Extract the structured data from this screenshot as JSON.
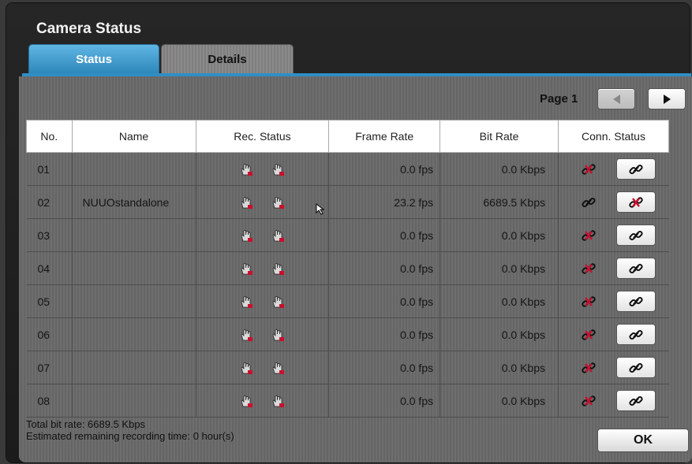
{
  "window": {
    "title": "Camera Status",
    "tabs": [
      {
        "label": "Status",
        "active": true
      },
      {
        "label": "Details",
        "active": false
      }
    ]
  },
  "pager": {
    "label": "Page 1"
  },
  "table": {
    "headers": [
      "No.",
      "Name",
      "Rec. Status",
      "Frame Rate",
      "Bit Rate",
      "Conn. Status"
    ],
    "rows": [
      {
        "no": "01",
        "name": "",
        "fps": "0.0 fps",
        "bitrate": "0.0 Kbps",
        "connected": false
      },
      {
        "no": "02",
        "name": "NUUOstandalone",
        "fps": "23.2 fps",
        "bitrate": "6689.5 Kbps",
        "connected": true
      },
      {
        "no": "03",
        "name": "",
        "fps": "0.0 fps",
        "bitrate": "0.0 Kbps",
        "connected": false
      },
      {
        "no": "04",
        "name": "",
        "fps": "0.0 fps",
        "bitrate": "0.0 Kbps",
        "connected": false
      },
      {
        "no": "05",
        "name": "",
        "fps": "0.0 fps",
        "bitrate": "0.0 Kbps",
        "connected": false
      },
      {
        "no": "06",
        "name": "",
        "fps": "0.0 fps",
        "bitrate": "0.0 Kbps",
        "connected": false
      },
      {
        "no": "07",
        "name": "",
        "fps": "0.0 fps",
        "bitrate": "0.0 Kbps",
        "connected": false
      },
      {
        "no": "08",
        "name": "",
        "fps": "0.0 fps",
        "bitrate": "0.0 Kbps",
        "connected": false
      }
    ]
  },
  "footer": {
    "total_bit_rate": "Total bit rate: 6689.5 Kbps",
    "remaining_time": "Estimated remaining recording time: 0 hour(s)",
    "ok_label": "OK"
  },
  "icons": {
    "rec_manual": "hand-icon",
    "rec_schedule": "hand-icon",
    "connected": "link-icon",
    "disconnected": "broken-link-icon",
    "prev_page": "triangle-left-icon",
    "next_page": "triangle-right-icon"
  },
  "colors": {
    "tab_active": "#2d86b9",
    "disconnect_red": "#c8102e"
  }
}
